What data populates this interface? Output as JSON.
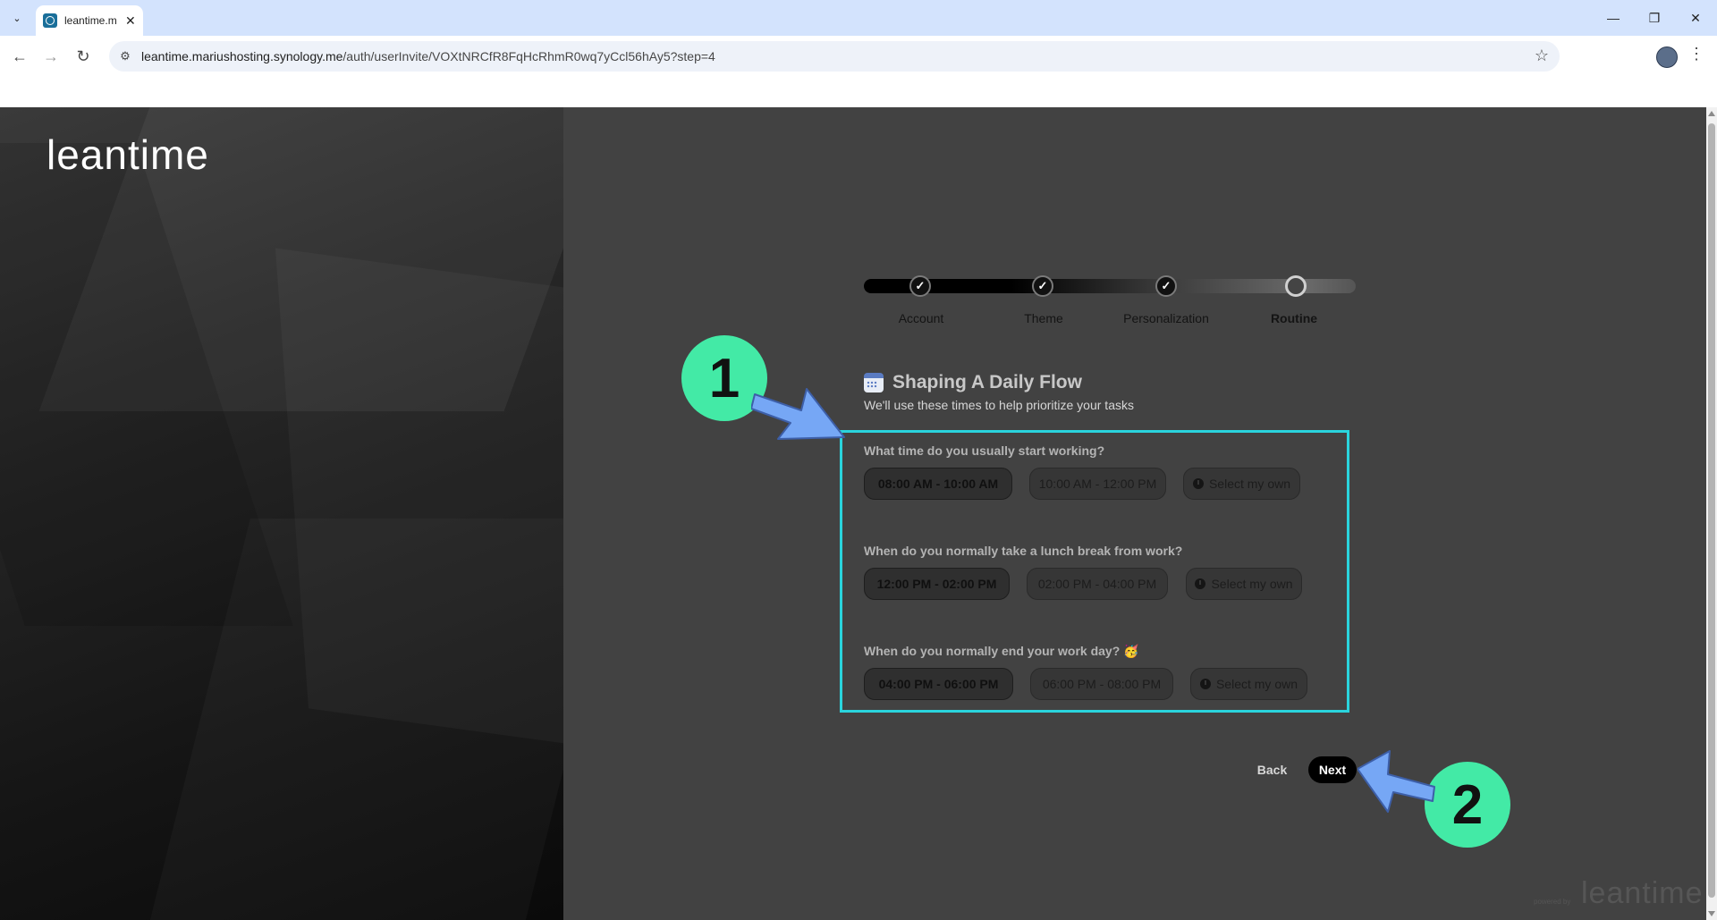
{
  "browser": {
    "tab_title": "leantime.m",
    "url_host": "leantime.mariushosting.synology.me",
    "url_path": "/auth/userInvite/VOXtNRCfR8FqHcRhmR0wq7yCcl56hAy5?step=4"
  },
  "brand": {
    "logo_text": "leantime",
    "footer_logo_text": "leantime",
    "powered_text": "powered by"
  },
  "stepper": {
    "steps": [
      {
        "label": "Account",
        "state": "done"
      },
      {
        "label": "Theme",
        "state": "done"
      },
      {
        "label": "Personalization",
        "state": "done"
      },
      {
        "label": "Routine",
        "state": "current"
      }
    ]
  },
  "content": {
    "title": "Shaping A Daily Flow",
    "subtitle": "We'll use these times to help prioritize your tasks",
    "questions": [
      {
        "text": "What time do you usually start working?",
        "options": [
          "08:00 AM - 10:00 AM",
          "10:00 AM - 12:00 PM",
          "Select my own"
        ]
      },
      {
        "text": "When do you normally take a lunch break from work?",
        "options": [
          "12:00 PM - 02:00 PM",
          "02:00 PM - 04:00 PM",
          "Select my own"
        ]
      },
      {
        "text": "When do you normally end your work day? 🥳",
        "options": [
          "04:00 PM - 06:00 PM",
          "06:00 PM - 08:00 PM",
          "Select my own"
        ]
      }
    ]
  },
  "actions": {
    "back_label": "Back",
    "next_label": "Next"
  },
  "annotations": {
    "marker_1": "1",
    "marker_2": "2",
    "marker_color": "#43eaa6",
    "arrow_color": "#76a7f5",
    "highlight_color": "#2ad4dd"
  },
  "icons": {
    "check": "✓",
    "window_minimize": "—",
    "window_restore": "❐",
    "window_close": "✕",
    "back": "←",
    "forward": "→",
    "reload": "↻",
    "star": "☆",
    "menu": "⋮",
    "tab_close": "✕",
    "chevron": "⌄"
  }
}
